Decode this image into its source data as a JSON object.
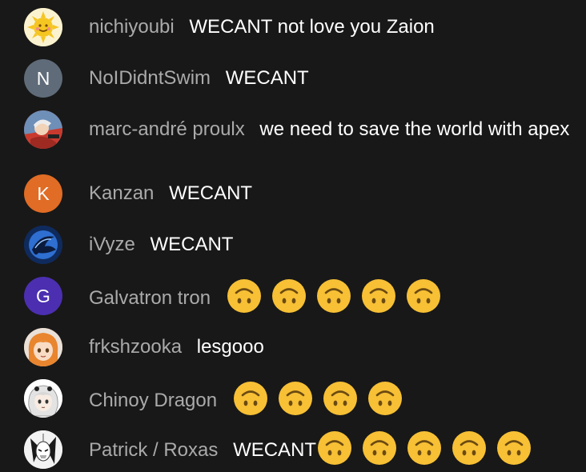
{
  "messages": [
    {
      "author": "nichiyoubi",
      "text": "WECANT not love you Zaion",
      "avatar": {
        "kind": "image",
        "icon": "sun-face-avatar",
        "bg": "#f6e27a"
      },
      "emojis": 0
    },
    {
      "author": "NoIDidntSwim",
      "text": "WECANT",
      "avatar": {
        "kind": "letter",
        "letter": "N",
        "bg": "#5f6b78"
      },
      "emojis": 0
    },
    {
      "author": "marc-andré proulx",
      "text": "we need to save the world with apex",
      "avatar": {
        "kind": "image",
        "icon": "anime-character-avatar",
        "bg": "#c93a2e"
      },
      "emojis": 0
    },
    {
      "author": "Kanzan",
      "text": "WECANT",
      "avatar": {
        "kind": "letter",
        "letter": "K",
        "bg": "#e06c25"
      },
      "emojis": 0
    },
    {
      "author": "iVyze",
      "text": "WECANT",
      "avatar": {
        "kind": "image",
        "icon": "blue-emblem-avatar",
        "bg": "#1b3d7a"
      },
      "emojis": 0
    },
    {
      "author": "Galvatron tron",
      "text": "",
      "avatar": {
        "kind": "letter",
        "letter": "G",
        "bg": "#4b2fb0"
      },
      "emojis": 5
    },
    {
      "author": "frkshzooka",
      "text": "lesgooo",
      "avatar": {
        "kind": "image",
        "icon": "orange-hair-girl-avatar",
        "bg": "#f0a35a"
      },
      "emojis": 0
    },
    {
      "author": "Chinoy Dragon",
      "text": "",
      "avatar": {
        "kind": "image",
        "icon": "white-hair-girl-avatar",
        "bg": "#e8e8e8"
      },
      "emojis": 4
    },
    {
      "author": "Patrick / Roxas",
      "text": "WECANT",
      "avatar": {
        "kind": "image",
        "icon": "masked-character-avatar",
        "bg": "#dcdcdc"
      },
      "emojis": 5
    }
  ],
  "emoji_name": "upside-down-face-emoji",
  "colors": {
    "background": "#181818",
    "author": "#aaaaaa",
    "text": "#ffffff",
    "emoji": "#f7c035"
  }
}
